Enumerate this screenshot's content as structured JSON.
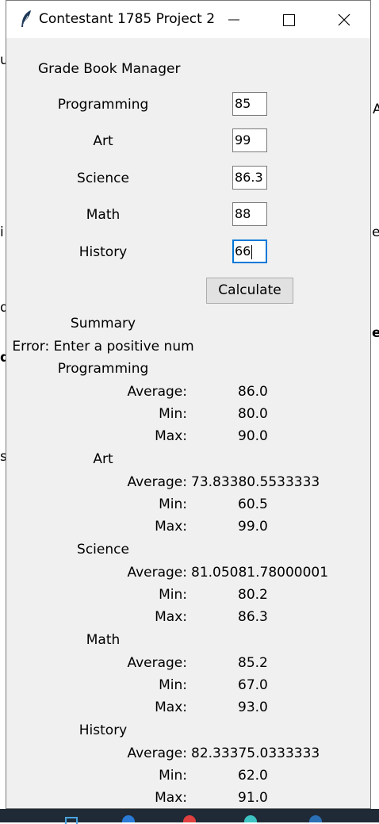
{
  "window": {
    "title": "Contestant 1785 Project 2"
  },
  "app": {
    "header": "Grade Book Manager",
    "calculate_label": "Calculate"
  },
  "subjects": [
    {
      "label": "Programming",
      "value": "85"
    },
    {
      "label": "Art",
      "value": "99"
    },
    {
      "label": "Science",
      "value": "86.3"
    },
    {
      "label": "Math",
      "value": "88"
    },
    {
      "label": "History",
      "value": "66"
    }
  ],
  "summary": {
    "title": "Summary",
    "error": "Error: Enter a positive num",
    "average_label": "Average:",
    "min_label": "Min:",
    "max_label": "Max:",
    "sections": [
      {
        "name": "Programming",
        "average": "86.0",
        "min": "80.0",
        "max": "90.0"
      },
      {
        "name": "Art",
        "average": "73.83380.5533333",
        "min": "60.5",
        "max": "99.0"
      },
      {
        "name": "Science",
        "average": "81.05081.78000001",
        "min": "80.2",
        "max": "86.3"
      },
      {
        "name": "Math",
        "average": "85.2",
        "min": "67.0",
        "max": "93.0"
      },
      {
        "name": "History",
        "average": "82.33375.0333333",
        "min": "62.0",
        "max": "91.0"
      }
    ]
  },
  "background_fragments": [
    "u",
    "A",
    "i",
    "e",
    "d",
    "e",
    "d",
    "s"
  ],
  "icons": [
    "feather-icon",
    "minimize-icon",
    "maximize-icon",
    "close-icon"
  ]
}
